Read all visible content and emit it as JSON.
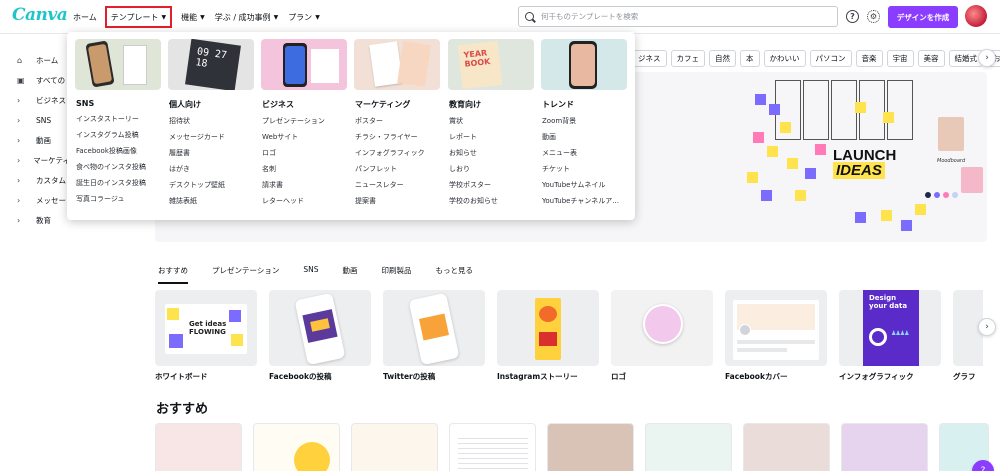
{
  "brand": {
    "logo": "Canva",
    "accent": "#8b3dff",
    "logo_color": "#20c4cb",
    "highlight": "#e0202a"
  },
  "nav": {
    "home": "ホーム",
    "templates": "テンプレート",
    "features": "機能",
    "learn": "学ぶ / 成功事例",
    "plans": "プラン"
  },
  "search": {
    "placeholder": "何千ものテンプレートを検索"
  },
  "header": {
    "help_icon": "?",
    "settings_icon": "gear-icon",
    "create_button": "デザインを作成"
  },
  "sidebar": {
    "items": [
      {
        "label": "ホーム",
        "icon": "home-icon"
      },
      {
        "label": "すべての",
        "icon": "grid-icon"
      },
      {
        "label": "ビジネス",
        "icon": "chevron-right-icon"
      },
      {
        "label": "SNS",
        "icon": "chevron-right-icon"
      },
      {
        "label": "動画",
        "icon": "chevron-right-icon"
      },
      {
        "label": "マーケティ",
        "icon": "chevron-right-icon"
      },
      {
        "label": "カスタム",
        "icon": "chevron-right-icon"
      },
      {
        "label": "メッセー",
        "icon": "chevron-right-icon"
      },
      {
        "label": "教育",
        "icon": "chevron-right-icon"
      }
    ]
  },
  "chips": [
    "ジネス",
    "カフェ",
    "自然",
    "本",
    "かわいい",
    "パソコン",
    "音楽",
    "宇宙",
    "美容",
    "結婚式",
    "おしゃ"
  ],
  "hero": {
    "headline_1": "LAUNCH",
    "headline_2": "IDEAS",
    "moodboard_label": "Moodboard"
  },
  "tabs": [
    "おすすめ",
    "プレゼンテーション",
    "SNS",
    "動画",
    "印刷製品",
    "もっと見る"
  ],
  "categories": [
    {
      "label": "ホワイトボード",
      "thumb_text": "Get ideas FLOWING"
    },
    {
      "label": "Facebookの投稿",
      "thumb_text": ""
    },
    {
      "label": "Twitterの投稿",
      "thumb_text": ""
    },
    {
      "label": "Instagramストーリー",
      "thumb_text": ""
    },
    {
      "label": "ロゴ",
      "thumb_text": ""
    },
    {
      "label": "Facebookカバー",
      "thumb_text": ""
    },
    {
      "label": "インフォグラフィック",
      "thumb_text": "Design your data"
    },
    {
      "label": "グラフ",
      "thumb_text": ""
    }
  ],
  "section": {
    "title": "おすすめ"
  },
  "dropdown": {
    "columns": [
      {
        "title": "SNS",
        "items": [
          "インスタストーリー",
          "インスタグラム投稿",
          "Facebook投稿画像",
          "食べ物のインスタ投稿",
          "誕生日のインスタ投稿",
          "写真コラージュ"
        ]
      },
      {
        "title": "個人向け",
        "thumb_text": "09 27 18",
        "items": [
          "招待状",
          "メッセージカード",
          "履歴書",
          "はがき",
          "デスクトップ壁紙",
          "雑誌表紙"
        ]
      },
      {
        "title": "ビジネス",
        "items": [
          "プレゼンテーション",
          "Webサイト",
          "ロゴ",
          "名刺",
          "請求書",
          "レターヘッド"
        ]
      },
      {
        "title": "マーケティング",
        "items": [
          "ポスター",
          "チラシ・フライヤー",
          "インフォグラフィック",
          "パンフレット",
          "ニュースレター",
          "提案書"
        ]
      },
      {
        "title": "教育向け",
        "thumb_text": "YEAR BOOK",
        "items": [
          "賞状",
          "レポート",
          "お知らせ",
          "しおり",
          "学校ポスター",
          "学校のお知らせ"
        ]
      },
      {
        "title": "トレンド",
        "items": [
          "Zoom背景",
          "動画",
          "メニュー表",
          "チケット",
          "YouTubeサムネイル",
          "YouTubeチャンネルア..."
        ]
      }
    ]
  }
}
